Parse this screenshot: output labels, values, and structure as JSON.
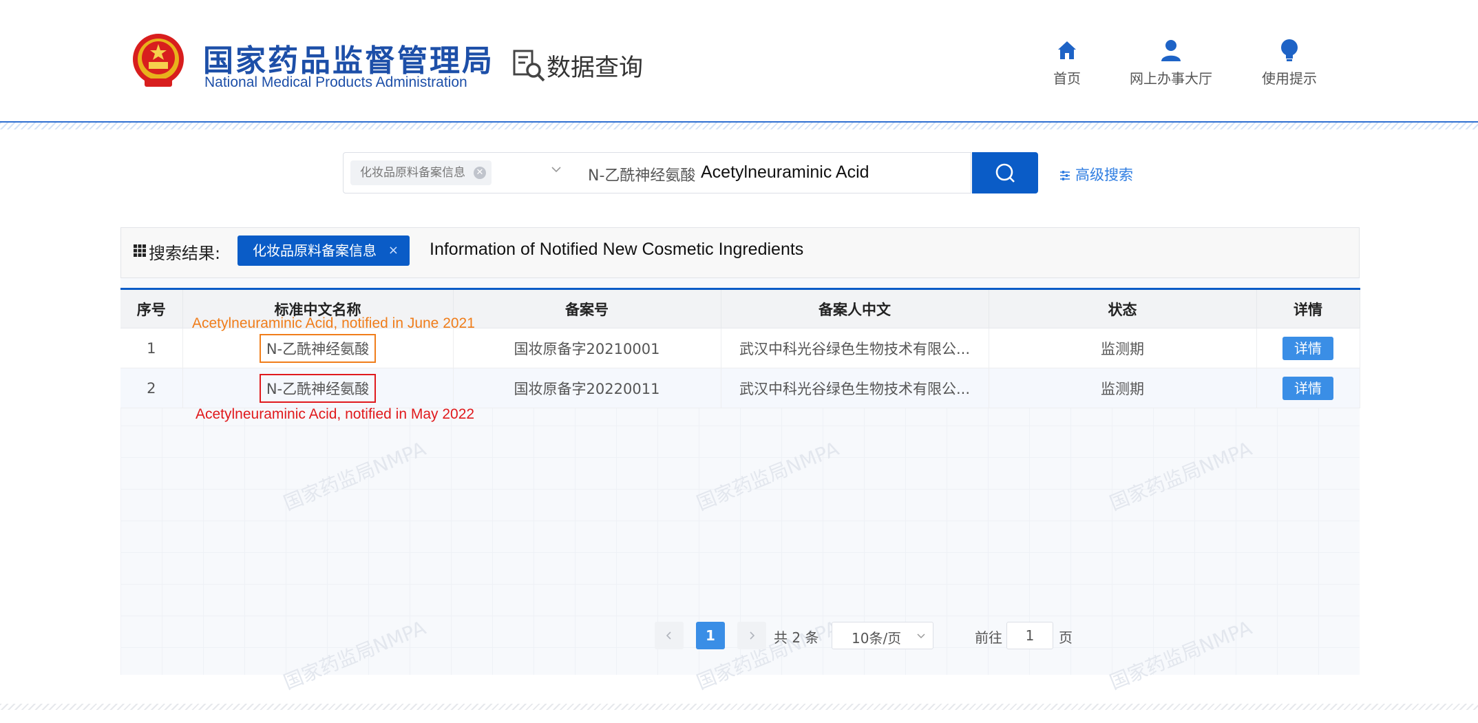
{
  "header": {
    "brand_cn": "国家药品监督管理局",
    "brand_en": "National Medical Products Administration",
    "data_query_label": "数据查询",
    "nav": [
      {
        "label": "首页",
        "icon": "home-icon"
      },
      {
        "label": "网上办事大厅",
        "icon": "user-icon"
      },
      {
        "label": "使用提示",
        "icon": "lightbulb-icon"
      }
    ]
  },
  "search": {
    "category_tag": "化妆品原料备案信息",
    "keyword": "N-乙酰神经氨酸",
    "keyword_overlay": "Acetylneuraminic Acid",
    "advanced_label": "高级搜索"
  },
  "results": {
    "label": "搜索结果:",
    "chip": "化妆品原料备案信息",
    "chip_close": "×",
    "overlay_en": "Information of Notified New Cosmetic Ingredients",
    "columns": [
      "序号",
      "标准中文名称",
      "备案号",
      "备案人中文",
      "状态",
      "详情"
    ],
    "rows": [
      {
        "index": "1",
        "name": "N-乙酰神经氨酸",
        "record_no": "国妆原备字20210001",
        "filer": "武汉中科光谷绿色生物技术有限公...",
        "status": "监测期",
        "detail": "详情"
      },
      {
        "index": "2",
        "name": "N-乙酰神经氨酸",
        "record_no": "国妆原备字20220011",
        "filer": "武汉中科光谷绿色生物技术有限公...",
        "status": "监测期",
        "detail": "详情"
      }
    ],
    "annotation_1": "Acetylneuraminic Acid, notified in June 2021",
    "annotation_2": "Acetylneuraminic Acid, notified in May 2022",
    "watermark": "国家药监局NMPA"
  },
  "pagination": {
    "current_page": "1",
    "total_text": "共 2 条",
    "page_size": "10条/页",
    "goto_label": "前往",
    "goto_value": "1",
    "page_suffix": "页"
  },
  "colors": {
    "brand_blue": "#1d4fa8",
    "primary": "#0a5cc7",
    "button_blue": "#3a8ee6",
    "annotation_orange": "#f07d1a",
    "annotation_red": "#e0191c"
  }
}
